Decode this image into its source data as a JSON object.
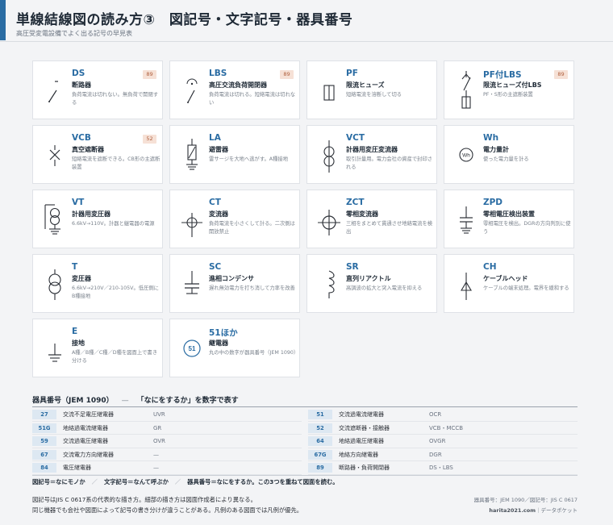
{
  "header": {
    "title": "単線結線図の読み方③　図記号・文字記号・器具番号",
    "subtitle": "高圧受変電設備でよく出る記号の早見表"
  },
  "cards": [
    {
      "code": "DS",
      "name": "断路器",
      "desc": "負荷電流は切れない。無負荷で開閉する",
      "badge": "89",
      "icon": "ds-symbol-icon"
    },
    {
      "code": "LBS",
      "name": "高圧交流負荷開閉器",
      "desc": "負荷電流は切れる。短絡電流は切れない",
      "badge": "89",
      "icon": "lbs-symbol-icon"
    },
    {
      "code": "PF",
      "name": "限流ヒューズ",
      "desc": "短絡電流を溶断して切る",
      "badge": "",
      "icon": "pf-symbol-icon"
    },
    {
      "code": "PF付LBS",
      "name": "限流ヒューズ付LBS",
      "desc": "PF・S形の主遮断装置",
      "badge": "89",
      "icon": "pf-lbs-symbol-icon"
    },
    {
      "code": "VCB",
      "name": "真空遮断器",
      "desc": "短絡電流を遮断できる。CB形の主遮断装置",
      "badge": "52",
      "icon": "vcb-symbol-icon"
    },
    {
      "code": "LA",
      "name": "避雷器",
      "desc": "雷サージを大地へ逃がす。A種接地",
      "badge": "",
      "icon": "la-symbol-icon"
    },
    {
      "code": "VCT",
      "name": "計器用変圧変流器",
      "desc": "取引計量用。電力会社の資産で封印される",
      "badge": "",
      "icon": "vct-symbol-icon"
    },
    {
      "code": "Wh",
      "name": "電力量計",
      "desc": "使った電力量を計る",
      "badge": "",
      "icon": "wh-meter-icon"
    },
    {
      "code": "VT",
      "name": "計器用変圧器",
      "desc": "6.6kV→110V。計器と継電器の電源",
      "badge": "",
      "icon": "vt-symbol-icon"
    },
    {
      "code": "CT",
      "name": "変流器",
      "desc": "負荷電流を小さくして計る。二次側は開放禁止",
      "badge": "",
      "icon": "ct-symbol-icon"
    },
    {
      "code": "ZCT",
      "name": "零相変流器",
      "desc": "三相をまとめて貫通させ地絡電流を検出",
      "badge": "",
      "icon": "zct-symbol-icon"
    },
    {
      "code": "ZPD",
      "name": "零相電圧検出装置",
      "desc": "零相電圧を検出。DGRの方向判別に使う",
      "badge": "",
      "icon": "zpd-symbol-icon"
    },
    {
      "code": "T",
      "name": "変圧器",
      "desc": "6.6kV→210V／210-105V。低圧側にB種接地",
      "badge": "",
      "icon": "transformer-symbol-icon"
    },
    {
      "code": "SC",
      "name": "進相コンデンサ",
      "desc": "遅れ無効電力を打ち消して力率を改善",
      "badge": "",
      "icon": "sc-symbol-icon"
    },
    {
      "code": "SR",
      "name": "直列リアクトル",
      "desc": "高調波の拡大と突入電流を抑える",
      "badge": "",
      "icon": "sr-symbol-icon"
    },
    {
      "code": "CH",
      "name": "ケーブルヘッド",
      "desc": "ケーブルの端末処理。電界を緩和する",
      "badge": "",
      "icon": "ch-symbol-icon"
    },
    {
      "code": "E",
      "name": "接地",
      "desc": "A種／B種／C種／D種を図面上で書き分ける",
      "badge": "",
      "icon": "earth-symbol-icon"
    },
    {
      "code": "51ほか",
      "name": "継電器",
      "desc": "丸の中の数字が器具番号（JEM 1090）",
      "badge": "",
      "icon": "relay-number-icon",
      "icon_text": "51"
    }
  ],
  "device_numbers": {
    "title": "器具番号（JEM 1090）",
    "dash": "—",
    "tagline": "「なにをするか」を数字で表す",
    "left": [
      {
        "num": "27",
        "name": "交流不足電圧継電器",
        "abbr": "UVR"
      },
      {
        "num": "51G",
        "name": "地絡過電流継電器",
        "abbr": "GR"
      },
      {
        "num": "59",
        "name": "交流過電圧継電器",
        "abbr": "OVR"
      },
      {
        "num": "67",
        "name": "交流電力方向継電器",
        "abbr": "—"
      },
      {
        "num": "84",
        "name": "電圧継電器",
        "abbr": "—"
      }
    ],
    "right": [
      {
        "num": "51",
        "name": "交流過電流継電器",
        "abbr": "OCR"
      },
      {
        "num": "52",
        "name": "交流遮断器・接触器",
        "abbr": "VCB・MCCB"
      },
      {
        "num": "64",
        "name": "地絡過電圧継電器",
        "abbr": "OVGR"
      },
      {
        "num": "67G",
        "name": "地絡方向継電器",
        "abbr": "DGR"
      },
      {
        "num": "89",
        "name": "断路器・負荷開閉器",
        "abbr": "DS・LBS"
      }
    ]
  },
  "summary": {
    "part1": "図記号＝なにモノか",
    "sep": "／",
    "part2": "文字記号＝なんて呼ぶか",
    "part3": "器具番号＝なにをするか。この3つを重ねて図面を読む。"
  },
  "footnote": {
    "line1": "図記号はJIS C 0617系の代表的な描き方。細部の描き方は図面作成者により異なる。",
    "line2": "同じ機器でも会社や図面によって記号の書き分けが違うことがある。凡例のある図面では凡例が優先。"
  },
  "credit": {
    "line1": "器具番号：JEM 1090／図記号：JIS C 0617",
    "site": "harita2021.com",
    "line2_tail": "｜データポケット"
  },
  "colors": {
    "accent": "#2a6ca3",
    "badge_bg": "#f6e1d6",
    "badge_fg": "#b0603f",
    "number_chip_bg": "#dde8f2"
  }
}
